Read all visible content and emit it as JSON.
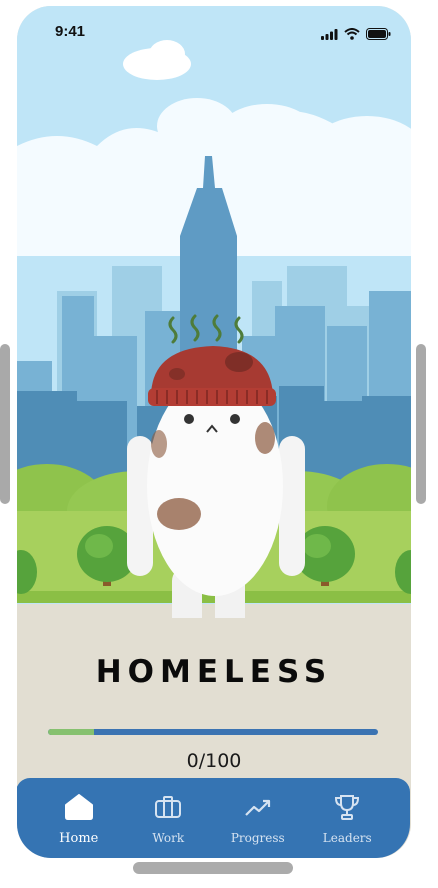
{
  "status_bar": {
    "time": "9:41"
  },
  "character": {
    "status_title": "HOMELESS"
  },
  "progress": {
    "current": 0,
    "max": 100,
    "fill_fraction": 0.14,
    "label": "0/100"
  },
  "colors": {
    "accent": "#3574b3",
    "progress_fill": "#86c16f",
    "sky": "#bfe5f7",
    "ground": "#e2ded2"
  },
  "tabs": [
    {
      "label": "Home",
      "icon": "house-icon",
      "active": true
    },
    {
      "label": "Work",
      "icon": "briefcase-icon",
      "active": false
    },
    {
      "label": "Progress",
      "icon": "trend-up-icon",
      "active": false
    },
    {
      "label": "Leaders",
      "icon": "trophy-icon",
      "active": false
    }
  ]
}
